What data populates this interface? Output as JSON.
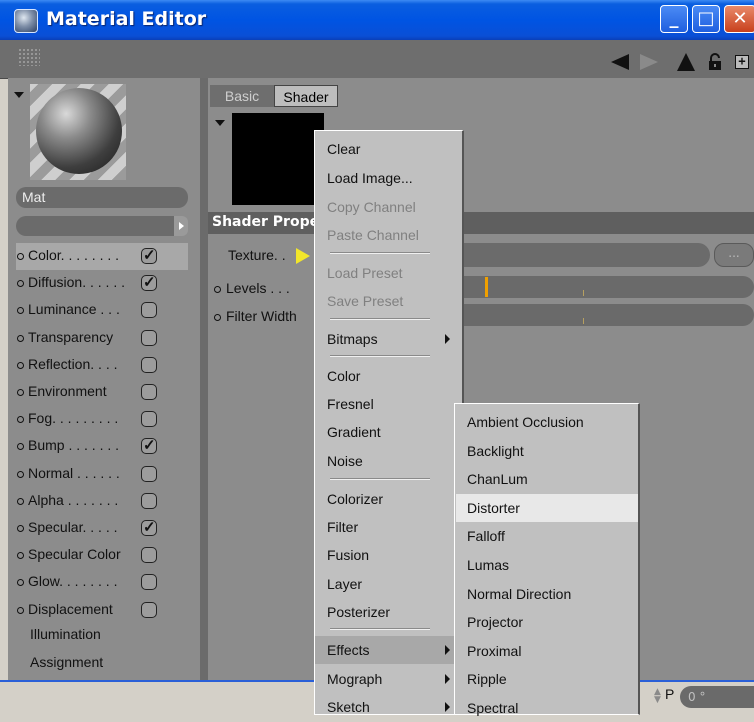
{
  "window": {
    "title": "Material Editor",
    "min_glyph": "_",
    "max_glyph": "□",
    "close_glyph": "✕",
    "expand_glyph": "+"
  },
  "material": {
    "name": "Mat"
  },
  "channels": [
    {
      "label": "Color. . . . . . . .",
      "has_checkbox": true,
      "checked": true
    },
    {
      "label": "Diffusion. . . . . .",
      "has_checkbox": true,
      "checked": true
    },
    {
      "label": "Luminance . . .",
      "has_checkbox": true,
      "checked": false
    },
    {
      "label": "Transparency",
      "has_checkbox": true,
      "checked": false
    },
    {
      "label": "Reflection. . . .",
      "has_checkbox": true,
      "checked": false
    },
    {
      "label": "Environment",
      "has_checkbox": true,
      "checked": false
    },
    {
      "label": "Fog. . . . . . . . .",
      "has_checkbox": true,
      "checked": false
    },
    {
      "label": "Bump . . . . . . .",
      "has_checkbox": true,
      "checked": true
    },
    {
      "label": "Normal . . . . . .",
      "has_checkbox": true,
      "checked": false
    },
    {
      "label": "Alpha . . . . . . .",
      "has_checkbox": true,
      "checked": false
    },
    {
      "label": "Specular. . . . .",
      "has_checkbox": true,
      "checked": true
    },
    {
      "label": "Specular Color",
      "has_checkbox": true,
      "checked": false
    },
    {
      "label": "Glow. . . . . . . .",
      "has_checkbox": true,
      "checked": false
    },
    {
      "label": "Displacement",
      "has_checkbox": true,
      "checked": false
    }
  ],
  "extra_items": [
    "Illumination",
    "Assignment"
  ],
  "tabs": {
    "basic": "Basic",
    "shader": "Shader"
  },
  "shader": {
    "section_title": "Shader Proper",
    "texture_label": "Texture. .",
    "levels_label": "Levels . . .",
    "filter_label": "Filter Width",
    "browse_label": "..."
  },
  "bottom": {
    "p_label": "P",
    "p_value": "0 °"
  },
  "context_menu": {
    "items": [
      {
        "label": "Clear",
        "disabled": false,
        "submenu": false
      },
      {
        "label": "Load Image...",
        "disabled": false,
        "submenu": false
      },
      {
        "label": "Copy Channel",
        "disabled": true,
        "submenu": false
      },
      {
        "label": "Paste Channel",
        "disabled": true,
        "submenu": false
      },
      {
        "label": "Load Preset",
        "disabled": true,
        "submenu": false
      },
      {
        "label": "Save Preset",
        "disabled": true,
        "submenu": false
      },
      {
        "label": "Bitmaps",
        "disabled": false,
        "submenu": true
      },
      {
        "label": "Color",
        "disabled": false,
        "submenu": false
      },
      {
        "label": "Fresnel",
        "disabled": false,
        "submenu": false
      },
      {
        "label": "Gradient",
        "disabled": false,
        "submenu": false
      },
      {
        "label": "Noise",
        "disabled": false,
        "submenu": false
      },
      {
        "label": "Colorizer",
        "disabled": false,
        "submenu": false
      },
      {
        "label": "Filter",
        "disabled": false,
        "submenu": false
      },
      {
        "label": "Fusion",
        "disabled": false,
        "submenu": false
      },
      {
        "label": "Layer",
        "disabled": false,
        "submenu": false
      },
      {
        "label": "Posterizer",
        "disabled": false,
        "submenu": false
      },
      {
        "label": "Effects",
        "disabled": false,
        "submenu": true
      },
      {
        "label": "Mograph",
        "disabled": false,
        "submenu": true
      },
      {
        "label": "Sketch",
        "disabled": false,
        "submenu": true
      }
    ]
  },
  "effects_submenu": {
    "items": [
      "Ambient Occlusion",
      "Backlight",
      "ChanLum",
      "Distorter",
      "Falloff",
      "Lumas",
      "Normal Direction",
      "Projector",
      "Proximal",
      "Ripple",
      "Spectral"
    ]
  }
}
